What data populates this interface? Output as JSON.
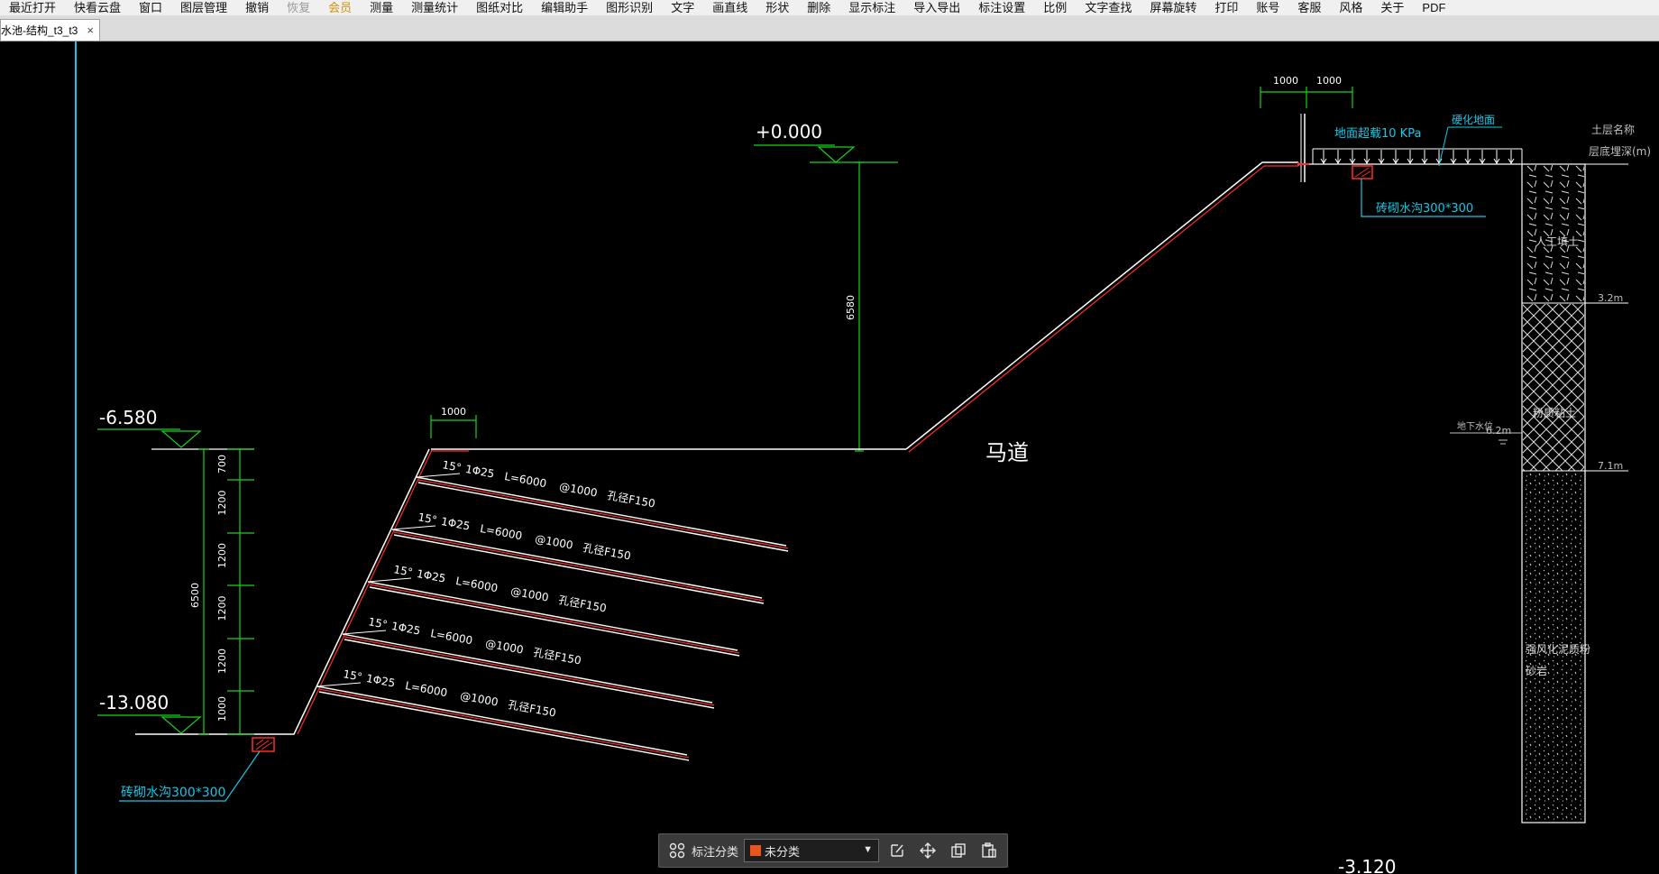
{
  "menu": [
    "最近打开",
    "快看云盘",
    "窗口",
    "图层管理",
    "撤销",
    "恢复",
    "会员",
    "测量",
    "测量统计",
    "图纸对比",
    "编辑助手",
    "图形识别",
    "文字",
    "画直线",
    "形状",
    "删除",
    "显示标注",
    "导入导出",
    "标注设置",
    "比例",
    "文字查找",
    "屏幕旋转",
    "打印",
    "账号",
    "客服",
    "风格",
    "关于",
    "PDF"
  ],
  "tab": {
    "title": "水池-结构_t3_t3",
    "close": "×"
  },
  "drawing": {
    "elev_top": "+0.000",
    "elev_mid": "-6.580",
    "elev_bottom": "-13.080",
    "elev_bottom_right": "-3.120",
    "dim_6580": "6580",
    "dim_1000_berm": "1000",
    "dim_1000_a": "1000",
    "dim_1000_b": "1000",
    "dims_left": [
      "700",
      "1200",
      "1200",
      "1200",
      "1200",
      "1000"
    ],
    "dim_6500": "6500",
    "berm_label": "马道",
    "anchors": [
      {
        "angle": "15°",
        "bar": "1Φ25",
        "len": "L=6000",
        "spacing": "@1000",
        "hole": "孔径F150"
      },
      {
        "angle": "15°",
        "bar": "1Φ25",
        "len": "L=6000",
        "spacing": "@1000",
        "hole": "孔径F150"
      },
      {
        "angle": "15°",
        "bar": "1Φ25",
        "len": "L=6000",
        "spacing": "@1000",
        "hole": "孔径F150"
      },
      {
        "angle": "15°",
        "bar": "1Φ25",
        "len": "L=6000",
        "spacing": "@1000",
        "hole": "孔径F150"
      },
      {
        "angle": "15°",
        "bar": "1Φ25",
        "len": "L=6000",
        "spacing": "@1000",
        "hole": "孔径F150"
      }
    ],
    "drain_bottom": "砖砌水沟300*300",
    "drain_top": "砖砌水沟300*300",
    "surcharge": "地面超载10 KPa",
    "hardened": "硬化地面",
    "soil_header_1": "土层名称",
    "soil_header_2": "层底埋深(m)",
    "soil_1": "人工填土",
    "depth_1": "3.2m",
    "soil_2": "粉质粘土",
    "water_label": "地下水位",
    "water_depth": "6.2m",
    "depth_2": "7.1m",
    "soil_3a": "强风化泥质粉",
    "soil_3b": "砂岩"
  },
  "toolbar": {
    "label": "标注分类",
    "selected": "未分类",
    "swatch": "#e8561e"
  },
  "colors": {
    "green": "#19d419",
    "cyan": "#14c8e6",
    "white": "#ffffff",
    "red": "#ff2a2a"
  }
}
